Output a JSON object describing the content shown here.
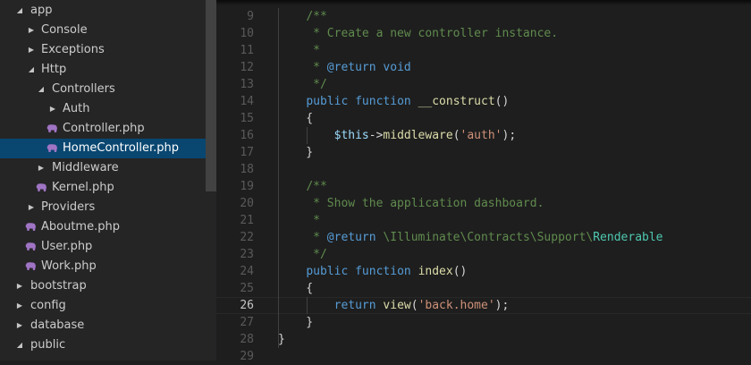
{
  "explorer": {
    "items": [
      {
        "label": "app",
        "twisty": "open",
        "icon": "none",
        "depth": 0
      },
      {
        "label": "Console",
        "twisty": "closed",
        "icon": "none",
        "depth": 1
      },
      {
        "label": "Exceptions",
        "twisty": "closed",
        "icon": "none",
        "depth": 1
      },
      {
        "label": "Http",
        "twisty": "open",
        "icon": "none",
        "depth": 1
      },
      {
        "label": "Controllers",
        "twisty": "open",
        "icon": "none",
        "depth": 2
      },
      {
        "label": "Auth",
        "twisty": "closed",
        "icon": "none",
        "depth": 3
      },
      {
        "label": "Controller.php",
        "twisty": "none",
        "icon": "php",
        "depth": 3
      },
      {
        "label": "HomeController.php",
        "twisty": "none",
        "icon": "php",
        "depth": 3,
        "selected": true
      },
      {
        "label": "Middleware",
        "twisty": "closed",
        "icon": "none",
        "depth": 2
      },
      {
        "label": "Kernel.php",
        "twisty": "none",
        "icon": "php",
        "depth": 2
      },
      {
        "label": "Providers",
        "twisty": "closed",
        "icon": "none",
        "depth": 1
      },
      {
        "label": "Aboutme.php",
        "twisty": "none",
        "icon": "php",
        "depth": 1
      },
      {
        "label": "User.php",
        "twisty": "none",
        "icon": "php",
        "depth": 1
      },
      {
        "label": "Work.php",
        "twisty": "none",
        "icon": "php",
        "depth": 1
      },
      {
        "label": "bootstrap",
        "twisty": "closed",
        "icon": "none",
        "depth": 0
      },
      {
        "label": "config",
        "twisty": "closed",
        "icon": "none",
        "depth": 0
      },
      {
        "label": "database",
        "twisty": "closed",
        "icon": "none",
        "depth": 0
      },
      {
        "label": "public",
        "twisty": "open",
        "icon": "none",
        "depth": 0
      }
    ]
  },
  "editor": {
    "first_visible_line": 9,
    "current_line": 26,
    "lines": [
      {
        "n": "9",
        "tokens": [
          [
            "    ",
            "txt"
          ],
          [
            "/**",
            "com"
          ]
        ]
      },
      {
        "n": "10",
        "tokens": [
          [
            "     * Create a new controller instance.",
            "com"
          ]
        ]
      },
      {
        "n": "11",
        "tokens": [
          [
            "     *",
            "com"
          ]
        ]
      },
      {
        "n": "12",
        "tokens": [
          [
            "     * ",
            "com"
          ],
          [
            "@return",
            "kw"
          ],
          [
            " ",
            "com"
          ],
          [
            "void",
            "kw"
          ]
        ]
      },
      {
        "n": "13",
        "tokens": [
          [
            "     */",
            "com"
          ]
        ]
      },
      {
        "n": "14",
        "tokens": [
          [
            "    ",
            "txt"
          ],
          [
            "public",
            "kw"
          ],
          [
            " ",
            "txt"
          ],
          [
            "function",
            "kw"
          ],
          [
            " ",
            "txt"
          ],
          [
            "__construct",
            "fn"
          ],
          [
            "()",
            "txt"
          ]
        ]
      },
      {
        "n": "15",
        "tokens": [
          [
            "    {",
            "txt"
          ]
        ]
      },
      {
        "n": "16",
        "tokens": [
          [
            "        ",
            "txt"
          ],
          [
            "$this",
            "var"
          ],
          [
            "->",
            "txt"
          ],
          [
            "middleware",
            "fn"
          ],
          [
            "(",
            "txt"
          ],
          [
            "'auth'",
            "str"
          ],
          [
            ");",
            "txt"
          ]
        ]
      },
      {
        "n": "17",
        "tokens": [
          [
            "    }",
            "txt"
          ]
        ]
      },
      {
        "n": "18",
        "tokens": []
      },
      {
        "n": "19",
        "tokens": [
          [
            "    ",
            "txt"
          ],
          [
            "/**",
            "com"
          ]
        ]
      },
      {
        "n": "20",
        "tokens": [
          [
            "     * Show the application dashboard.",
            "com"
          ]
        ]
      },
      {
        "n": "21",
        "tokens": [
          [
            "     *",
            "com"
          ]
        ]
      },
      {
        "n": "22",
        "tokens": [
          [
            "     * ",
            "com"
          ],
          [
            "@return",
            "kw"
          ],
          [
            " \\Illuminate\\Contracts\\Support\\",
            "com"
          ],
          [
            "Renderable",
            "cls"
          ]
        ]
      },
      {
        "n": "23",
        "tokens": [
          [
            "     */",
            "com"
          ]
        ]
      },
      {
        "n": "24",
        "tokens": [
          [
            "    ",
            "txt"
          ],
          [
            "public",
            "kw"
          ],
          [
            " ",
            "txt"
          ],
          [
            "function",
            "kw"
          ],
          [
            " ",
            "txt"
          ],
          [
            "index",
            "fn"
          ],
          [
            "()",
            "txt"
          ]
        ]
      },
      {
        "n": "25",
        "tokens": [
          [
            "    {",
            "txt"
          ]
        ]
      },
      {
        "n": "26",
        "tokens": [
          [
            "        ",
            "txt"
          ],
          [
            "return",
            "kw"
          ],
          [
            " ",
            "txt"
          ],
          [
            "view",
            "fn"
          ],
          [
            "(",
            "txt"
          ],
          [
            "'back.home'",
            "str"
          ],
          [
            ");",
            "txt"
          ]
        ]
      },
      {
        "n": "27",
        "tokens": [
          [
            "    }",
            "txt"
          ]
        ]
      },
      {
        "n": "28",
        "tokens": [
          [
            "}",
            "txt"
          ]
        ]
      },
      {
        "n": "29",
        "tokens": []
      }
    ]
  },
  "colors": {
    "selection": "#094771",
    "php_icon": "#a074c4",
    "keyword": "#569cd6",
    "comment": "#608b4e",
    "function": "#dcdcaa",
    "string": "#ce9178",
    "variable": "#9cdcfe",
    "class": "#4ec9b0"
  }
}
